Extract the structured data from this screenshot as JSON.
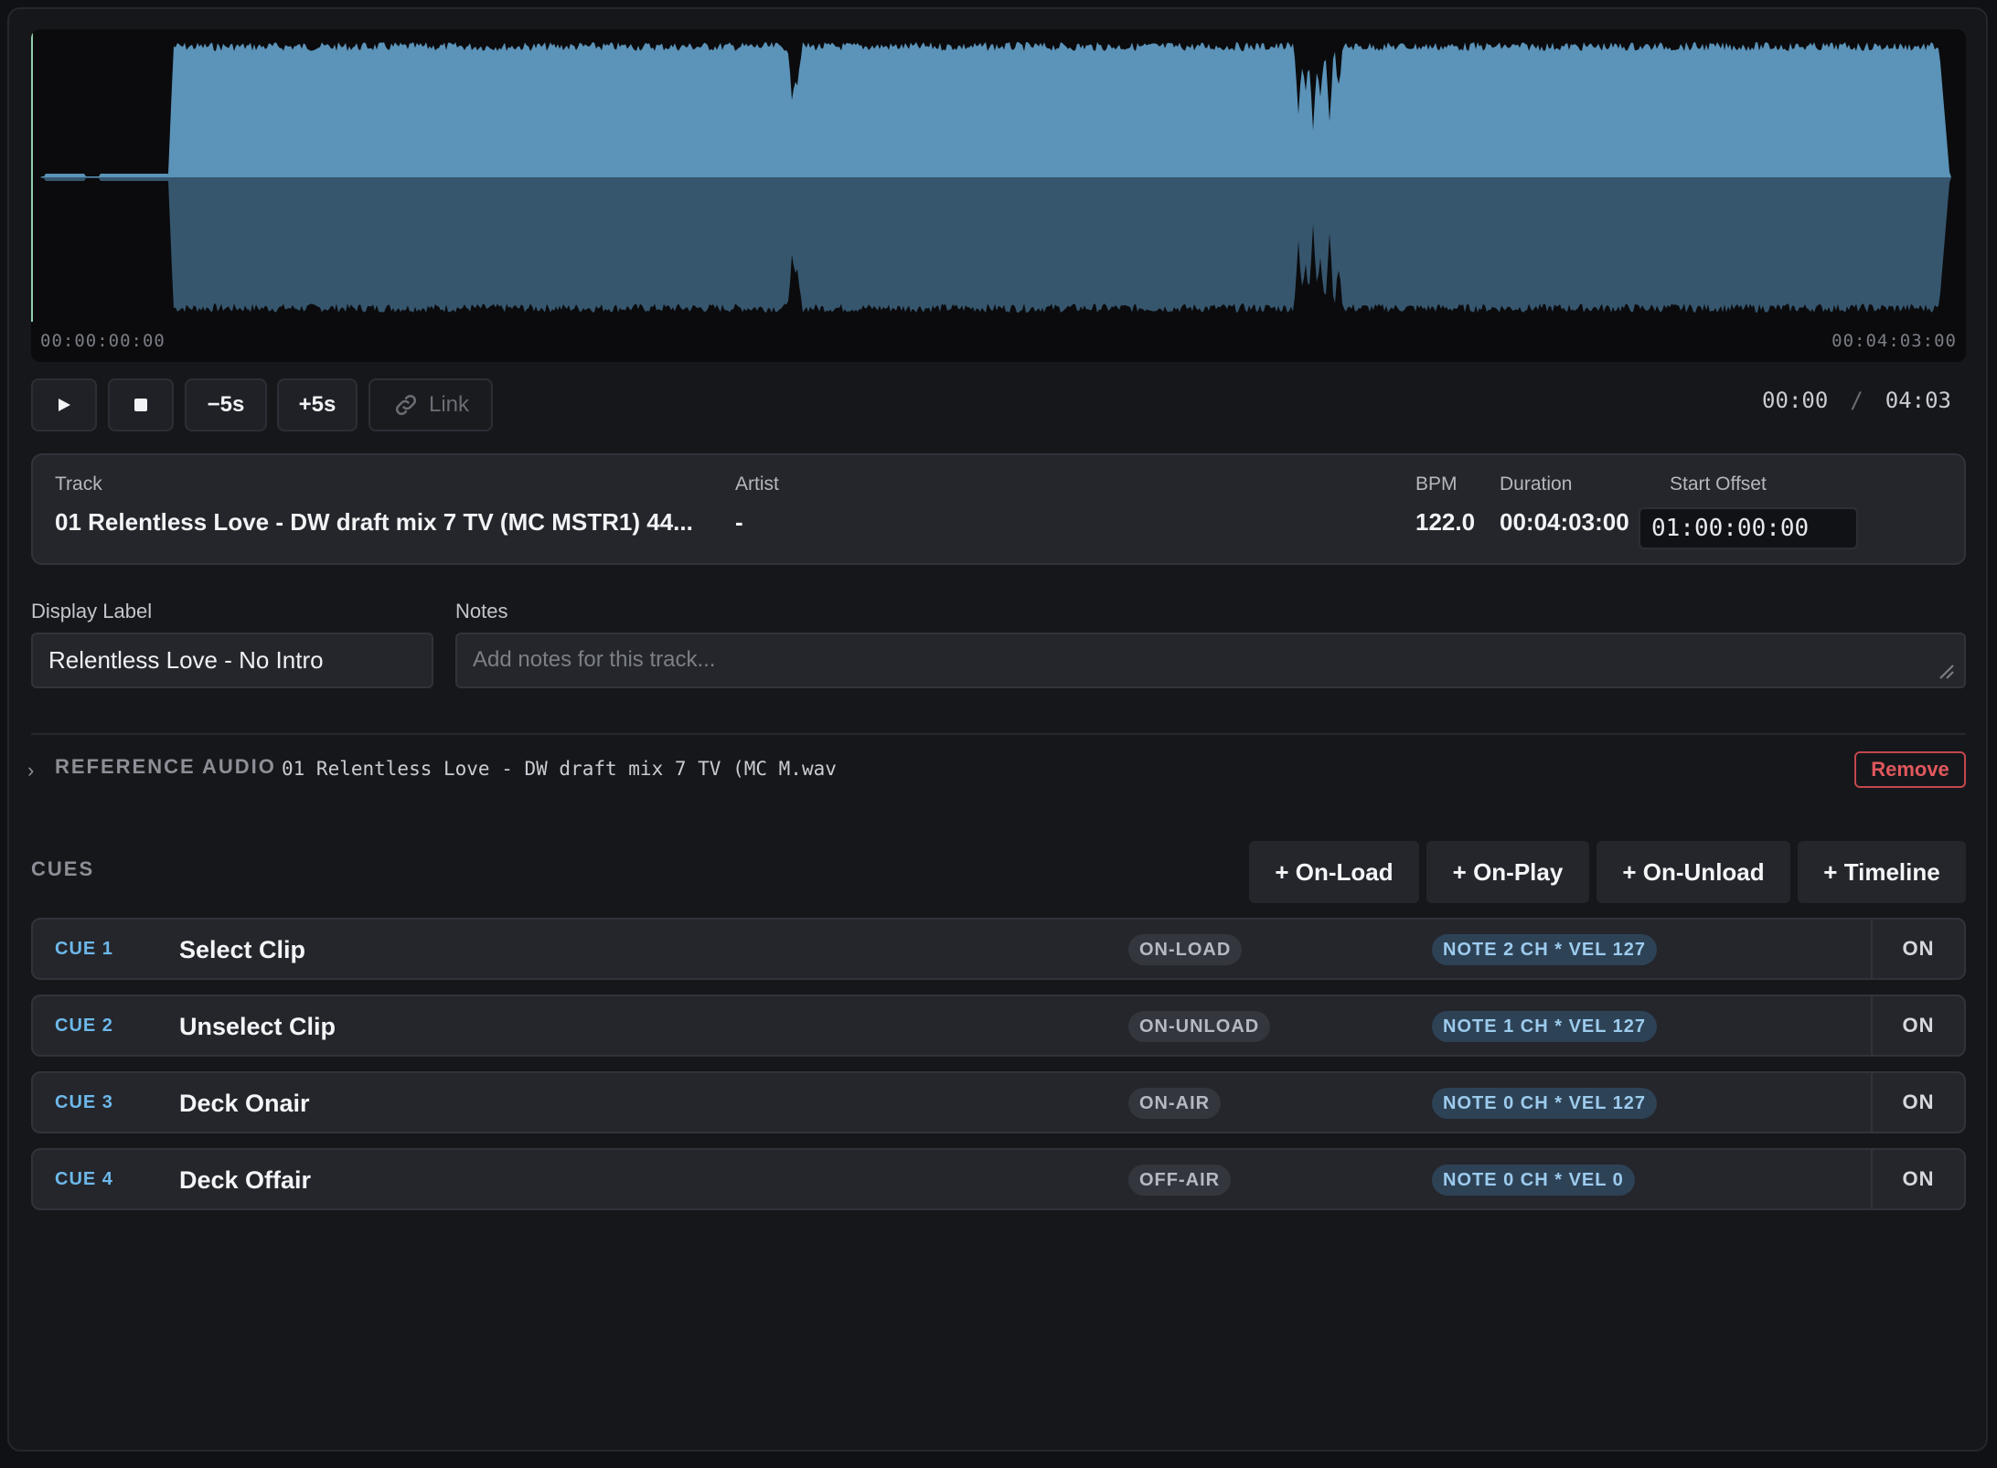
{
  "waveform": {
    "start_time": "00:00:00:00",
    "end_time": "00:04:03:00"
  },
  "transport": {
    "play_icon": "play-icon",
    "stop_icon": "stop-icon",
    "back_label": "−5s",
    "forward_label": "+5s",
    "link_label": "Link",
    "link_icon": "link-icon",
    "current_time": "00:00",
    "separator": "/",
    "total_time": "04:03"
  },
  "track": {
    "track_label": "Track",
    "track_value": "01 Relentless Love - DW draft mix 7 TV (MC MSTR1) 44...",
    "artist_label": "Artist",
    "artist_value": "-",
    "bpm_label": "BPM",
    "bpm_value": "122.0",
    "duration_label": "Duration",
    "duration_value": "00:04:03:00",
    "start_offset_label": "Start Offset",
    "start_offset_value": "01:00:00:00"
  },
  "display_label": {
    "label": "Display Label",
    "value": "Relentless Love - No Intro"
  },
  "notes": {
    "label": "Notes",
    "placeholder": "Add notes for this track..."
  },
  "reference_audio": {
    "title": "REFERENCE AUDIO",
    "file": "01 Relentless Love - DW draft mix 7 TV (MC M.wav",
    "remove_label": "Remove"
  },
  "cues": {
    "title": "CUES",
    "add_buttons": [
      "+ On-Load",
      "+ On-Play",
      "+ On-Unload",
      "+ Timeline"
    ],
    "items": [
      {
        "id": "CUE 1",
        "name": "Select Clip",
        "trigger": "ON-LOAD",
        "midi": "NOTE 2 CH * VEL 127",
        "state": "ON"
      },
      {
        "id": "CUE 2",
        "name": "Unselect Clip",
        "trigger": "ON-UNLOAD",
        "midi": "NOTE 1 CH * VEL 127",
        "state": "ON"
      },
      {
        "id": "CUE 3",
        "name": "Deck Onair",
        "trigger": "ON-AIR",
        "midi": "NOTE 0 CH * VEL 127",
        "state": "ON"
      },
      {
        "id": "CUE 4",
        "name": "Deck Offair",
        "trigger": "OFF-AIR",
        "midi": "NOTE 0 CH * VEL 0",
        "state": "ON"
      }
    ]
  },
  "colors": {
    "wave_top": "#5b93b9",
    "wave_bottom": "#36566e",
    "accent": "#6db8ea",
    "danger": "#e0585c"
  }
}
